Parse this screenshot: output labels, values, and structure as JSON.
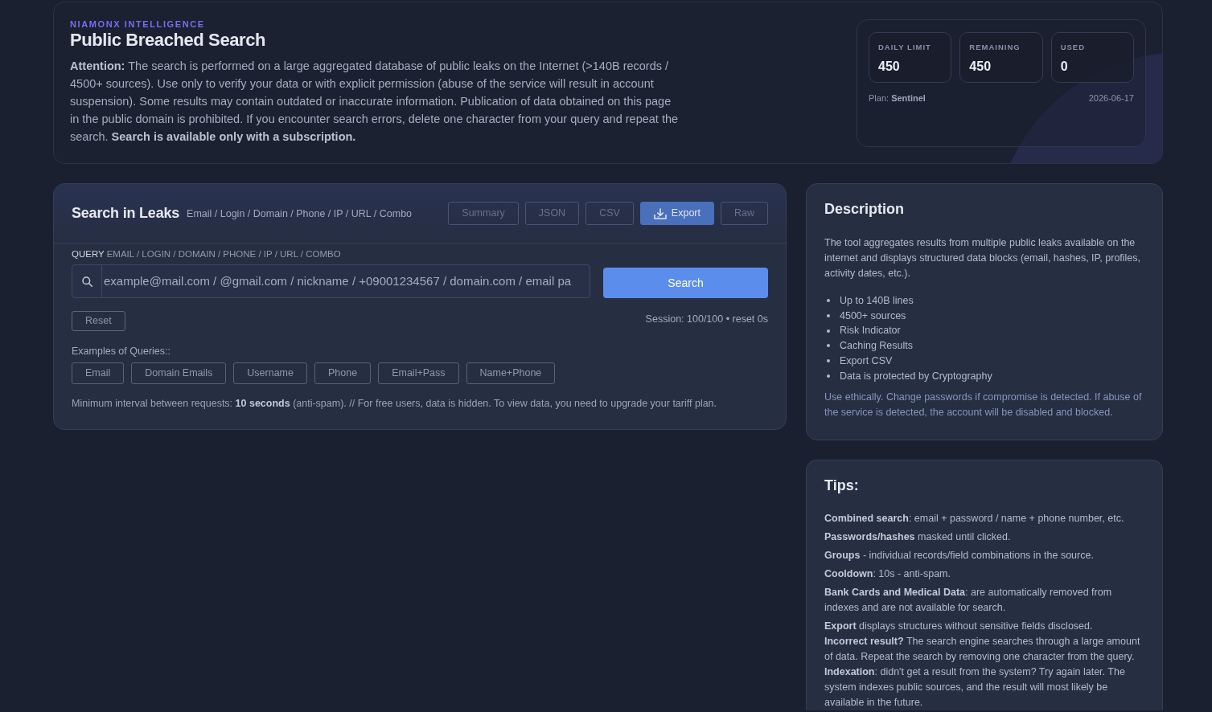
{
  "header": {
    "kicker": "NIAMONX INTELLIGENCE",
    "title": "Public Breached Search",
    "notice": "**Attention:** The search is performed on a large aggregated database of public leaks on the Internet (>140B records / 4500+ sources). Use only to verify your data or with explicit permission (abuse of the service will result in account suspension). Some results may contain outdated or inaccurate information. Publication of data obtained on this page in the public domain is prohibited. If you encounter search errors, delete one character from your query and repeat the search. **Search is available only with a subscription.**"
  },
  "quota": {
    "stats": [
      {
        "label": "DAILY LIMIT",
        "value": "450"
      },
      {
        "label": "REMAINING",
        "value": "450"
      },
      {
        "label": "USED",
        "value": "0"
      }
    ],
    "plan": "Plan: **Sentinel**",
    "date": "2026-06-17"
  },
  "search_panel": {
    "title": "Search in Leaks",
    "subtitle": "Email / Login / Domain / Phone / IP / URL / Combo",
    "view_buttons": [
      {
        "label": "Summary",
        "kind": "plain",
        "disabled": true
      },
      {
        "label": "JSON",
        "kind": "plain",
        "disabled": true
      },
      {
        "label": "CSV",
        "kind": "plain",
        "disabled": true
      },
      {
        "label": "Export",
        "kind": "download",
        "disabled": false
      },
      {
        "label": "Raw",
        "kind": "plain",
        "disabled": true
      }
    ],
    "query_label": "**QUERY** EMAIL / LOGIN / DOMAIN / PHONE / IP / URL / COMBO",
    "query_field": {
      "placeholder": "example@mail.com / @gmail.com / nickname / +09001234567 / domain.com / email pa"
    },
    "search_button": "Search",
    "reset_button": "Reset",
    "session": "Session: 100/100 • reset 0s",
    "examples_label": "Examples of Queries::",
    "examples": [
      "Email",
      "Domain Emails",
      "Username",
      "Phone",
      "Email+Pass",
      "Name+Phone"
    ],
    "note": "Minimum interval between requests: **10 seconds** (anti-spam). // For free users, data is hidden. To view data, you need to upgrade your tariff plan."
  },
  "description": {
    "title": "Description",
    "intro": "The tool aggregates results from multiple public leaks available on the internet and displays structured data blocks (email, hashes, IP, profiles, activity dates, etc.).",
    "features": [
      "Up to 140B lines",
      "4500+ sources",
      "Risk Indicator",
      "Caching Results",
      "Export CSV",
      "Data is protected by Cryptography"
    ],
    "footer": "Use ethically. Change passwords if compromise is detected. If abuse of the service is detected, the account will be disabled and blocked."
  },
  "tips": {
    "title": "Tips:",
    "paragraphs": [
      [
        "**Combined search**: email + password / name + phone number, etc."
      ],
      [
        "**Passwords/hashes** masked until clicked."
      ],
      [
        "**Groups** - individual records/field combinations in the source."
      ],
      [
        "**Cooldown**: 10s - anti-spam."
      ],
      [
        "**Bank Cards and Medical Data**: are automatically removed from indexes and are not available for search."
      ],
      [
        "**Export** displays structures without sensitive fields disclosed.",
        "**Incorrect result?** The search engine searches through a large amount of data. Repeat the search by removing one character from the query.",
        "**Indexation**: didn't get a result from the system? Try again later. The system indexes public sources, and the result will most likely be available in the future."
      ]
    ]
  }
}
